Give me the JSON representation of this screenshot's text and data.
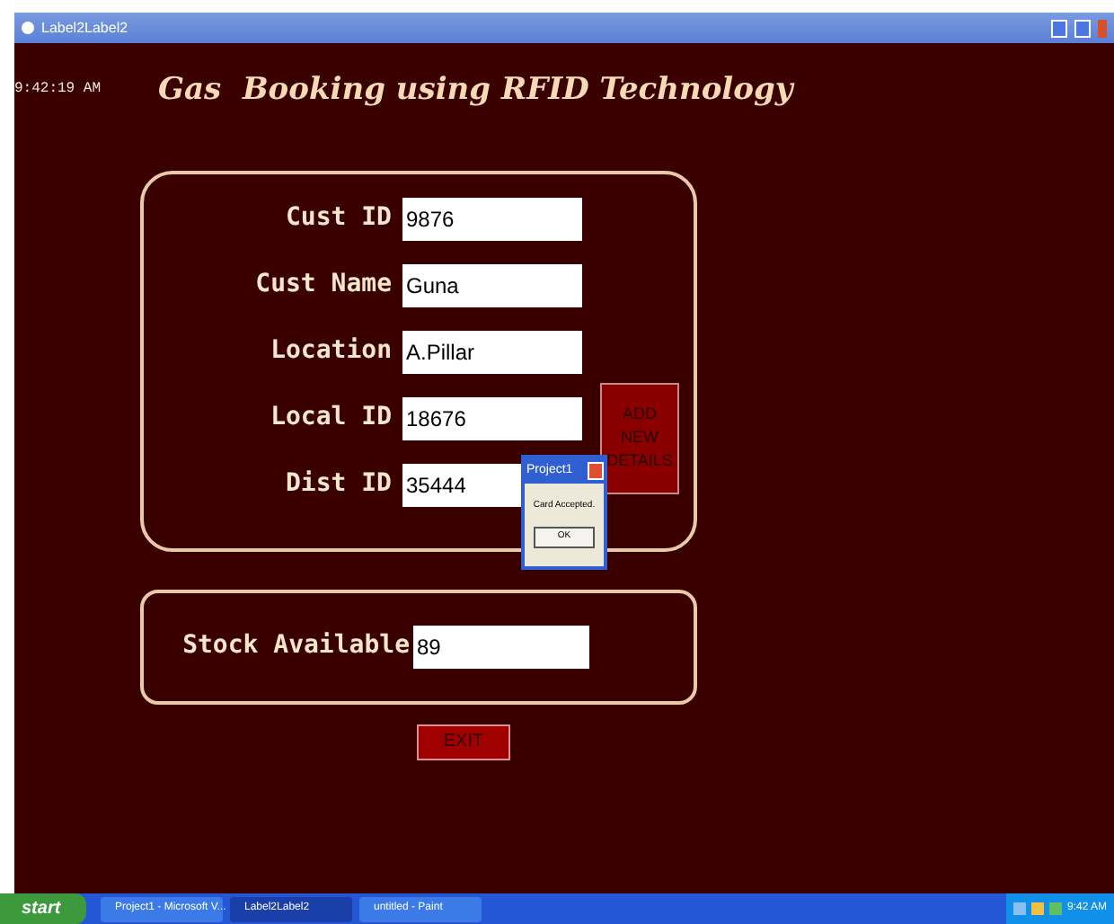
{
  "window": {
    "title": "Label2Label2"
  },
  "clock": "9:42:19 AM",
  "heading": "Gas  Booking using RFID Technology",
  "fields": [
    {
      "label": "Cust ID",
      "value": "9876"
    },
    {
      "label": "Cust Name",
      "value": "Guna"
    },
    {
      "label": "Location",
      "value": "A.Pillar"
    },
    {
      "label": "Local ID",
      "value": "18676"
    },
    {
      "label": "Dist ID",
      "value": "35444"
    }
  ],
  "add_button": "ADD NEW DETAILS",
  "dialog": {
    "title": "Project1",
    "message": "Card Accepted.",
    "button": "OK"
  },
  "stock": {
    "label": "Stock Available",
    "value": "89"
  },
  "exit_button": "EXIT",
  "taskbar": {
    "start": "start",
    "tasks": [
      {
        "label": "Project1 - Microsoft V...",
        "selected": false
      },
      {
        "label": "Label2Label2",
        "selected": true
      },
      {
        "label": "untitled - Paint",
        "selected": false
      }
    ],
    "time": "9:42 AM"
  }
}
